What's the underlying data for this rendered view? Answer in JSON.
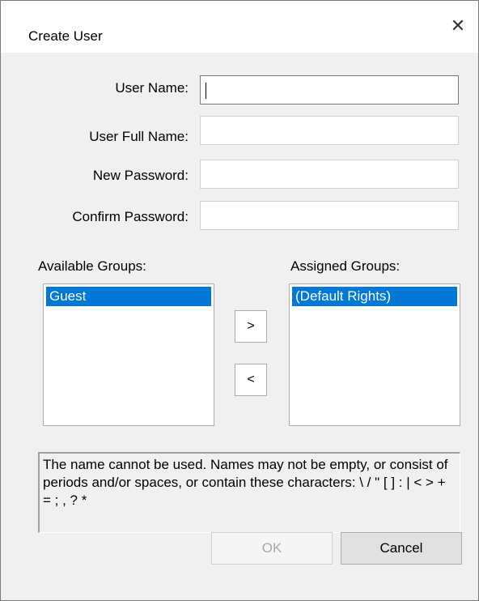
{
  "window": {
    "title": "Create User",
    "close_glyph": "✕"
  },
  "form": {
    "user_name_label": "User Name:",
    "user_name_value": "",
    "user_full_name_label": "User Full Name:",
    "user_full_name_value": "",
    "new_password_label": "New Password:",
    "new_password_value": "",
    "confirm_password_label": "Confirm Password:",
    "confirm_password_value": ""
  },
  "groups": {
    "available_label": "Available Groups:",
    "available_items": [
      "Guest"
    ],
    "assigned_label": "Assigned Groups:",
    "assigned_items": [
      "(Default Rights)"
    ],
    "add_button": ">",
    "remove_button": "<"
  },
  "message": "The name cannot be used. Names may not be empty, or consist of periods and/or spaces, or contain these characters: \\ / \" [ ] : | < > + = ; , ? *",
  "buttons": {
    "ok_label": "OK",
    "cancel_label": "Cancel"
  },
  "colors": {
    "selection": "#0078d7",
    "dialog_bg": "#f0f0f0"
  }
}
